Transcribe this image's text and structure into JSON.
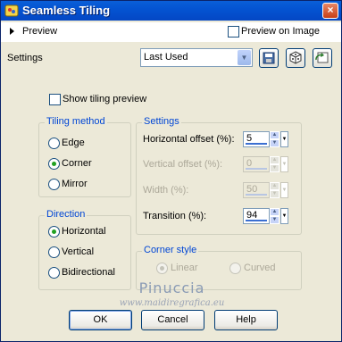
{
  "window": {
    "title": "Seamless Tiling",
    "close_label": "×"
  },
  "preview_section": {
    "label": "Preview",
    "preview_on_image_label": "Preview on Image",
    "preview_on_image_checked": false
  },
  "settings_bar": {
    "label": "Settings",
    "preset_value": "Last Used",
    "icons": [
      "save-preset-icon",
      "randomize-icon",
      "reset-icon"
    ]
  },
  "show_tiling_preview": {
    "label": "Show tiling preview",
    "checked": false
  },
  "tiling_method": {
    "legend": "Tiling method",
    "options": [
      {
        "label": "Edge",
        "selected": false
      },
      {
        "label": "Corner",
        "selected": true
      },
      {
        "label": "Mirror",
        "selected": false
      }
    ]
  },
  "direction": {
    "legend": "Direction",
    "options": [
      {
        "label": "Horizontal",
        "selected": true
      },
      {
        "label": "Vertical",
        "selected": false
      },
      {
        "label": "Bidirectional",
        "selected": false
      }
    ]
  },
  "settings_group": {
    "legend": "Settings",
    "fields": [
      {
        "label": "Horizontal offset (%):",
        "value": "5",
        "enabled": true
      },
      {
        "label": "Vertical offset (%):",
        "value": "0",
        "enabled": false
      },
      {
        "label": "Width (%):",
        "value": "50",
        "enabled": false
      },
      {
        "label": "Transition (%):",
        "value": "94",
        "enabled": true
      }
    ]
  },
  "corner_style": {
    "legend": "Corner style",
    "options": [
      {
        "label": "Linear",
        "selected": true,
        "enabled": false
      },
      {
        "label": "Curved",
        "selected": false,
        "enabled": false
      }
    ]
  },
  "watermark": {
    "name": "Pinuccia",
    "site": "www.maidiregrafica.eu"
  },
  "buttons": {
    "ok": "OK",
    "cancel": "Cancel",
    "help": "Help"
  }
}
